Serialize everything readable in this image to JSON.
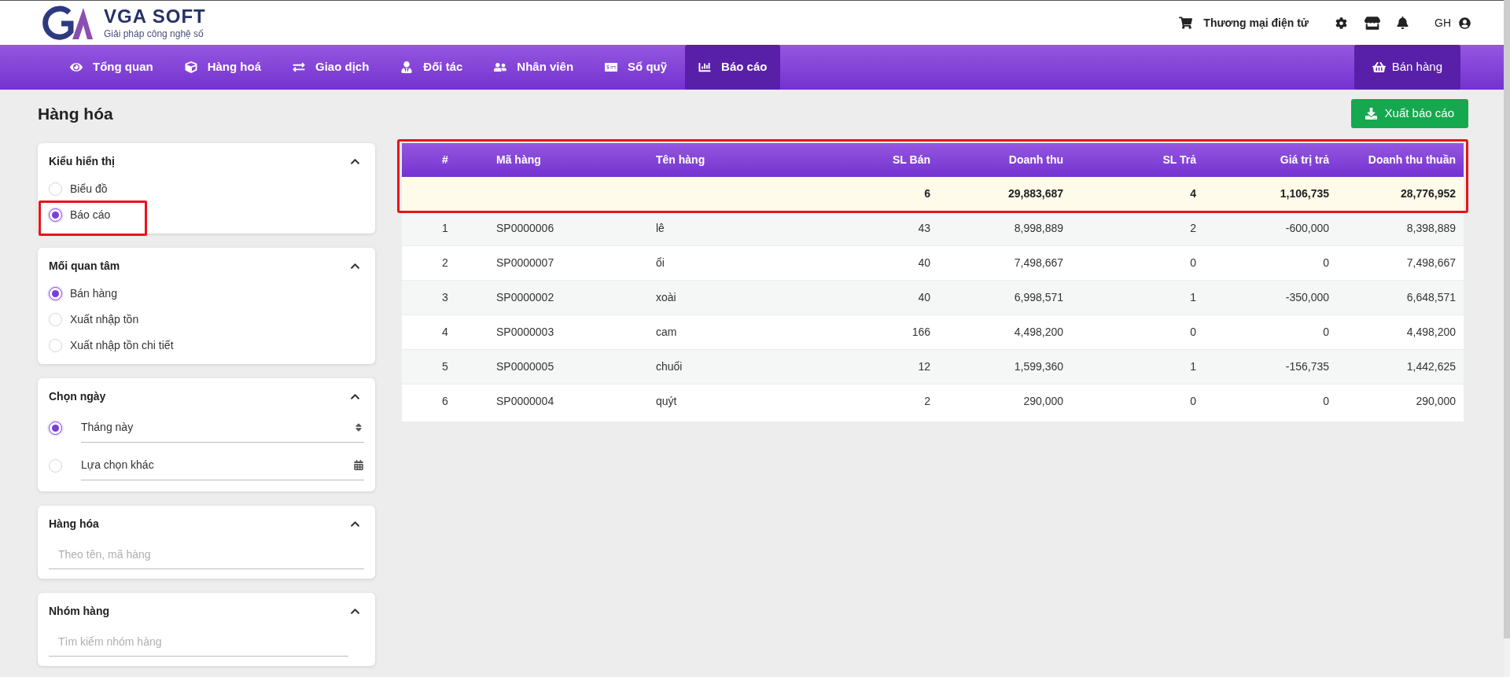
{
  "header": {
    "brand": "VGA SOFT",
    "tagline": "Giải pháp công nghệ số",
    "shop_link": "Thương mại điện tử",
    "user": "GH"
  },
  "nav": {
    "items": [
      {
        "label": "Tổng quan",
        "selected": false
      },
      {
        "label": "Hàng hoá",
        "selected": false
      },
      {
        "label": "Giao dịch",
        "selected": false
      },
      {
        "label": "Đối tác",
        "selected": false
      },
      {
        "label": "Nhân viên",
        "selected": false
      },
      {
        "label": "Sổ quỹ",
        "selected": false
      },
      {
        "label": "Báo cáo",
        "selected": true
      }
    ],
    "sell_button": "Bán hàng"
  },
  "page": {
    "title": "Hàng hóa",
    "export_button": "Xuất báo cáo"
  },
  "filters": [
    {
      "kind": "radio",
      "title": "Kiểu hiển thị",
      "expanded": true,
      "options": [
        {
          "label": "Biểu đồ",
          "selected": false,
          "highlighted": false
        },
        {
          "label": "Báo cáo",
          "selected": true,
          "highlighted": true
        }
      ]
    },
    {
      "kind": "radio",
      "title": "Mối quan tâm",
      "expanded": true,
      "options": [
        {
          "label": "Bán hàng",
          "selected": true
        },
        {
          "label": "Xuất nhập tồn",
          "selected": false
        },
        {
          "label": "Xuất nhập tồn chi tiết",
          "selected": false
        }
      ]
    },
    {
      "kind": "date",
      "title": "Chọn ngày",
      "expanded": true,
      "options": [
        {
          "label": "Tháng này",
          "selected": true,
          "kind": "select"
        },
        {
          "label": "Lựa chọn khác",
          "selected": false,
          "kind": "calendar"
        }
      ]
    },
    {
      "kind": "search",
      "title": "Hàng hóa",
      "expanded": true,
      "placeholder": "Theo tên, mã hàng"
    },
    {
      "kind": "search",
      "title": "Nhóm hàng",
      "expanded": true,
      "placeholder": "Tìm kiếm nhóm hàng"
    }
  ],
  "table": {
    "highlighted": true,
    "columns": [
      "#",
      "Mã hàng",
      "Tên hàng",
      "SL Bán",
      "Doanh thu",
      "SL Trả",
      "Giá trị trả",
      "Doanh thu thuần"
    ],
    "summary": [
      "6",
      "29,883,687",
      "4",
      "1,106,735",
      "28,776,952"
    ],
    "rows": [
      [
        "1",
        "SP0000006",
        "lê",
        "43",
        "8,998,889",
        "2",
        "-600,000",
        "8,398,889"
      ],
      [
        "2",
        "SP0000007",
        "ổi",
        "40",
        "7,498,667",
        "0",
        "0",
        "7,498,667"
      ],
      [
        "3",
        "SP0000002",
        "xoài",
        "40",
        "6,998,571",
        "1",
        "-350,000",
        "6,648,571"
      ],
      [
        "4",
        "SP0000003",
        "cam",
        "166",
        "4,498,200",
        "0",
        "0",
        "4,498,200"
      ],
      [
        "5",
        "SP0000005",
        "chuối",
        "12",
        "1,599,360",
        "1",
        "-156,735",
        "1,442,625"
      ],
      [
        "6",
        "SP0000004",
        "quýt",
        "2",
        "290,000",
        "0",
        "0",
        "290,000"
      ]
    ]
  }
}
